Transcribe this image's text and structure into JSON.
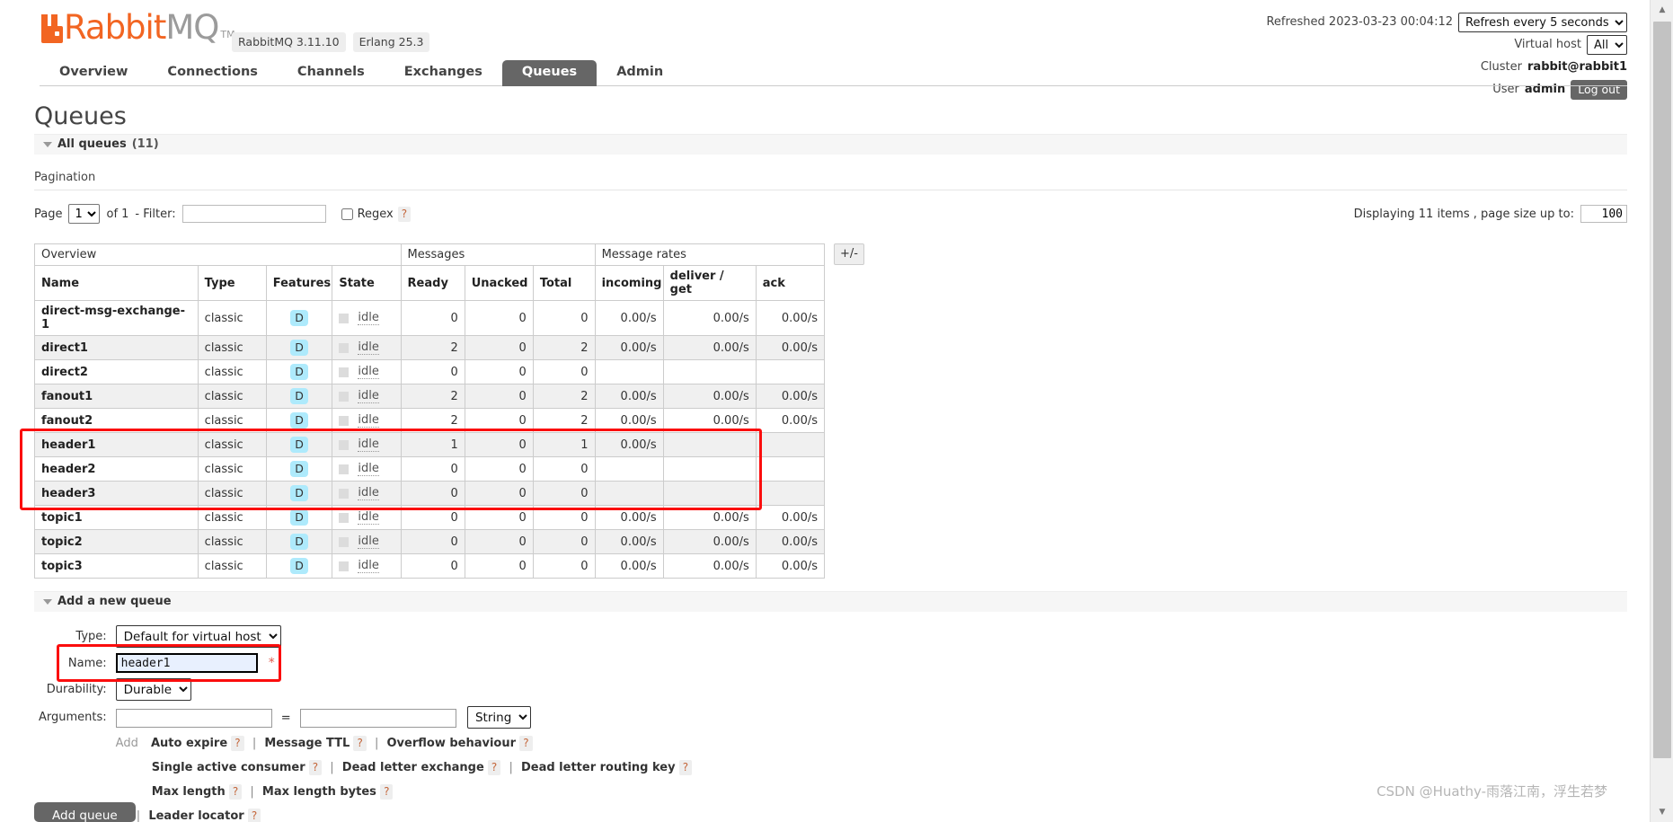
{
  "brand": {
    "name_part1": "Rabbit",
    "name_part2": "MQ",
    "tm": "TM",
    "version_badges": [
      "RabbitMQ 3.11.10",
      "Erlang 25.3"
    ]
  },
  "header": {
    "refreshed_label": "Refreshed 2023-03-23 00:04:12",
    "refresh_select_value": "Refresh every 5 seconds",
    "refresh_options": [
      "Refresh every 5 seconds"
    ],
    "vhost_label": "Virtual host",
    "vhost_value": "All",
    "vhost_options": [
      "All"
    ],
    "cluster_label": "Cluster",
    "cluster_value": "rabbit@rabbit1",
    "user_label": "User",
    "user_value": "admin",
    "logout_label": "Log out"
  },
  "nav": {
    "items": [
      {
        "label": "Overview",
        "active": false
      },
      {
        "label": "Connections",
        "active": false
      },
      {
        "label": "Channels",
        "active": false
      },
      {
        "label": "Exchanges",
        "active": false
      },
      {
        "label": "Queues",
        "active": true
      },
      {
        "label": "Admin",
        "active": false
      }
    ]
  },
  "page": {
    "title": "Queues",
    "all_queues_label": "All queues",
    "all_queues_count": "(11)",
    "pagination_label": "Pagination"
  },
  "filter": {
    "page_label": "Page",
    "page_value": "1",
    "page_options": [
      "1"
    ],
    "of_label": "of 1",
    "filter_label": "- Filter:",
    "filter_value": "",
    "filter_placeholder": "",
    "regex_label": "Regex",
    "help_glyph": "?",
    "displaying_text": "Displaying 11 items , page size up to:",
    "page_size_value": "100"
  },
  "table": {
    "group_headers": [
      {
        "label": "Overview",
        "span": 4
      },
      {
        "label": "Messages",
        "span": 3
      },
      {
        "label": "Message rates",
        "span": 3
      }
    ],
    "columns": [
      "Name",
      "Type",
      "Features",
      "State",
      "Ready",
      "Unacked",
      "Total",
      "incoming",
      "deliver / get",
      "ack"
    ],
    "plus_minus_label": "+/-",
    "feature_badge": "D",
    "state_text": "idle",
    "rows": [
      {
        "name": "direct-msg-exchange-1",
        "type": "classic",
        "features": "D",
        "state": "idle",
        "ready": "0",
        "unacked": "0",
        "total": "0",
        "incoming": "0.00/s",
        "deliver_get": "0.00/s",
        "ack": "0.00/s"
      },
      {
        "name": "direct1",
        "type": "classic",
        "features": "D",
        "state": "idle",
        "ready": "2",
        "unacked": "0",
        "total": "2",
        "incoming": "0.00/s",
        "deliver_get": "0.00/s",
        "ack": "0.00/s"
      },
      {
        "name": "direct2",
        "type": "classic",
        "features": "D",
        "state": "idle",
        "ready": "0",
        "unacked": "0",
        "total": "0",
        "incoming": "",
        "deliver_get": "",
        "ack": ""
      },
      {
        "name": "fanout1",
        "type": "classic",
        "features": "D",
        "state": "idle",
        "ready": "2",
        "unacked": "0",
        "total": "2",
        "incoming": "0.00/s",
        "deliver_get": "0.00/s",
        "ack": "0.00/s"
      },
      {
        "name": "fanout2",
        "type": "classic",
        "features": "D",
        "state": "idle",
        "ready": "2",
        "unacked": "0",
        "total": "2",
        "incoming": "0.00/s",
        "deliver_get": "0.00/s",
        "ack": "0.00/s"
      },
      {
        "name": "header1",
        "type": "classic",
        "features": "D",
        "state": "idle",
        "ready": "1",
        "unacked": "0",
        "total": "1",
        "incoming": "0.00/s",
        "deliver_get": "",
        "ack": ""
      },
      {
        "name": "header2",
        "type": "classic",
        "features": "D",
        "state": "idle",
        "ready": "0",
        "unacked": "0",
        "total": "0",
        "incoming": "",
        "deliver_get": "",
        "ack": ""
      },
      {
        "name": "header3",
        "type": "classic",
        "features": "D",
        "state": "idle",
        "ready": "0",
        "unacked": "0",
        "total": "0",
        "incoming": "",
        "deliver_get": "",
        "ack": ""
      },
      {
        "name": "topic1",
        "type": "classic",
        "features": "D",
        "state": "idle",
        "ready": "0",
        "unacked": "0",
        "total": "0",
        "incoming": "0.00/s",
        "deliver_get": "0.00/s",
        "ack": "0.00/s"
      },
      {
        "name": "topic2",
        "type": "classic",
        "features": "D",
        "state": "idle",
        "ready": "0",
        "unacked": "0",
        "total": "0",
        "incoming": "0.00/s",
        "deliver_get": "0.00/s",
        "ack": "0.00/s"
      },
      {
        "name": "topic3",
        "type": "classic",
        "features": "D",
        "state": "idle",
        "ready": "0",
        "unacked": "0",
        "total": "0",
        "incoming": "0.00/s",
        "deliver_get": "0.00/s",
        "ack": "0.00/s"
      }
    ]
  },
  "add_queue": {
    "section_label": "Add a new queue",
    "type_label": "Type:",
    "type_value": "Default for virtual host",
    "type_options": [
      "Default for virtual host"
    ],
    "name_label": "Name:",
    "name_value": "header1",
    "name_required_mark": "*",
    "durability_label": "Durability:",
    "durability_value": "Durable",
    "durability_options": [
      "Durable"
    ],
    "arguments_label": "Arguments:",
    "arg_key_value": "",
    "arg_val_value": "",
    "arg_type_value": "String",
    "arg_type_options": [
      "String"
    ],
    "add_label": "Add",
    "presets_row1": [
      "Auto expire",
      "Message TTL",
      "Overflow behaviour"
    ],
    "presets_row2": [
      "Single active consumer",
      "Dead letter exchange",
      "Dead letter routing key"
    ],
    "presets_row3": [
      "Max length",
      "Max length bytes"
    ],
    "presets_row4": [
      "Leader locator"
    ],
    "submit_label": "Add queue"
  },
  "highlight": {
    "color": "#fb0d0d"
  },
  "watermark": {
    "text": "CSDN @Huathy-雨落江南，浮生若梦"
  }
}
